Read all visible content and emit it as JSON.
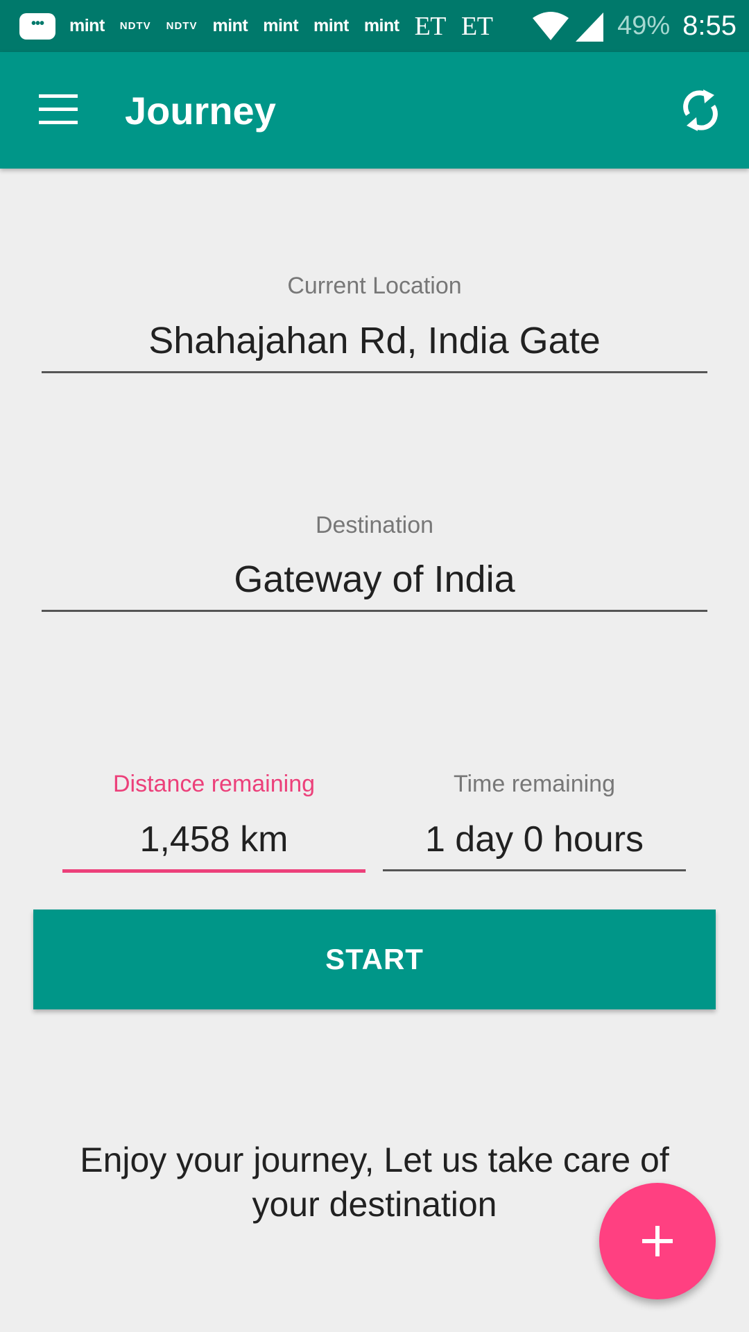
{
  "status_bar": {
    "notifications": [
      "mint",
      "NDTV",
      "NDTV",
      "mint",
      "mint",
      "mint",
      "mint",
      "ET",
      "ET"
    ],
    "battery": "49%",
    "time": "8:55",
    "icons": [
      "message-icon",
      "wifi-icon",
      "signal-icon"
    ]
  },
  "app_bar": {
    "title": "Journey",
    "menu_icon": "hamburger-menu-icon",
    "refresh_icon": "refresh-icon"
  },
  "current_location": {
    "label": "Current Location",
    "value": "Shahajahan Rd, India Gate"
  },
  "destination": {
    "label": "Destination",
    "value": "Gateway of India"
  },
  "distance": {
    "label": "Distance remaining",
    "value": "1,458 km"
  },
  "time_remaining": {
    "label": "Time remaining",
    "value": "1 day 0 hours"
  },
  "start_button": {
    "label": "START"
  },
  "tagline": "Enjoy your journey, Let us take care of your destination",
  "fab": {
    "icon": "plus-icon"
  },
  "colors": {
    "primary": "#009688",
    "primary_dark": "#00796b",
    "accent": "#ff4081",
    "background": "#eeeeee"
  }
}
